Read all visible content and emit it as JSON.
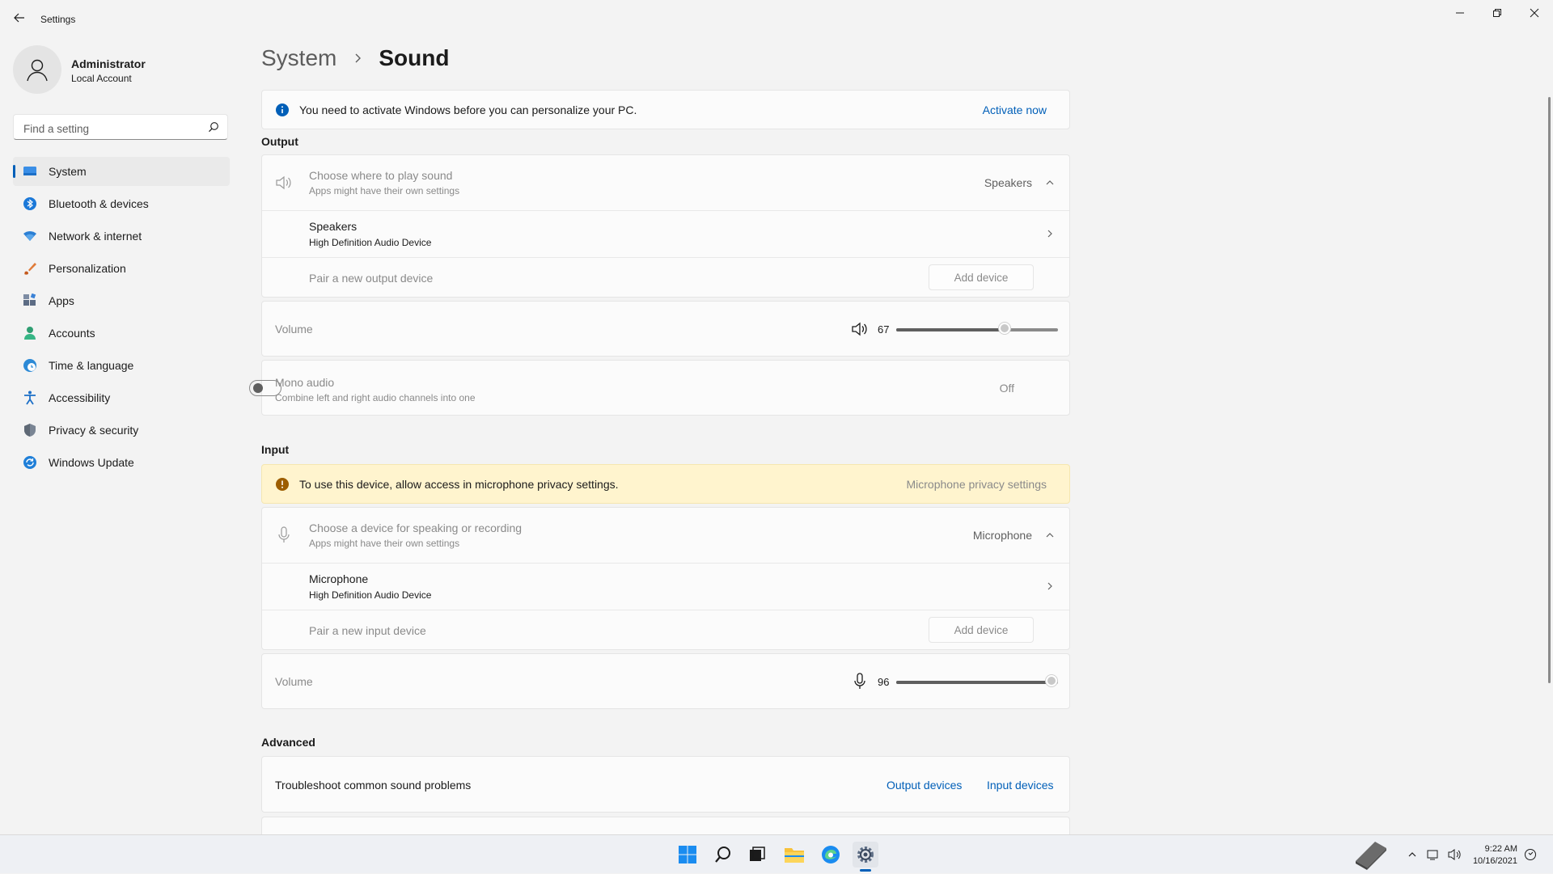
{
  "window": {
    "title": "Settings",
    "controls": [
      "minimize",
      "restore",
      "close"
    ]
  },
  "account": {
    "name": "Administrator",
    "type": "Local Account"
  },
  "search": {
    "placeholder": "Find a setting"
  },
  "sidebar": {
    "items": [
      {
        "label": "System",
        "icon": "system-icon",
        "active": true
      },
      {
        "label": "Bluetooth & devices",
        "icon": "bluetooth-icon"
      },
      {
        "label": "Network & internet",
        "icon": "wifi-icon"
      },
      {
        "label": "Personalization",
        "icon": "brush-icon"
      },
      {
        "label": "Apps",
        "icon": "apps-icon"
      },
      {
        "label": "Accounts",
        "icon": "person-icon"
      },
      {
        "label": "Time & language",
        "icon": "globe-clock-icon"
      },
      {
        "label": "Accessibility",
        "icon": "accessibility-icon"
      },
      {
        "label": "Privacy & security",
        "icon": "shield-icon"
      },
      {
        "label": "Windows Update",
        "icon": "update-icon"
      }
    ]
  },
  "breadcrumb": {
    "parent": "System",
    "current": "Sound"
  },
  "activation_banner": {
    "text": "You need to activate Windows before you can personalize your PC.",
    "link": "Activate now"
  },
  "output": {
    "section_title": "Output",
    "choose": {
      "title": "Choose where to play sound",
      "subtitle": "Apps might have their own settings",
      "value": "Speakers"
    },
    "device": {
      "title": "Speakers",
      "subtitle": "High Definition Audio Device"
    },
    "pair": {
      "label": "Pair a new output device",
      "button": "Add device"
    },
    "volume": {
      "label": "Volume",
      "value": "67",
      "level": 67
    },
    "mono": {
      "title": "Mono audio",
      "subtitle": "Combine left and right audio channels into one",
      "state": "Off"
    }
  },
  "input": {
    "section_title": "Input",
    "warning": {
      "text": "To use this device, allow access in microphone privacy settings.",
      "link": "Microphone privacy settings"
    },
    "choose": {
      "title": "Choose a device for speaking or recording",
      "subtitle": "Apps might have their own settings",
      "value": "Microphone"
    },
    "device": {
      "title": "Microphone",
      "subtitle": "High Definition Audio Device"
    },
    "pair": {
      "label": "Pair a new input device",
      "button": "Add device"
    },
    "volume": {
      "label": "Volume",
      "value": "96",
      "level": 96
    }
  },
  "advanced": {
    "section_title": "Advanced",
    "troubleshoot": {
      "label": "Troubleshoot common sound problems",
      "output_link": "Output devices",
      "input_link": "Input devices"
    }
  },
  "taskbar": {
    "apps": [
      "start-icon",
      "search-icon",
      "task-view-icon",
      "file-explorer-icon",
      "edge-icon",
      "settings-icon"
    ],
    "time": "9:22 AM",
    "date": "10/16/2021"
  },
  "colors": {
    "accent": "#005fb8",
    "warning_bg": "#fff4ce",
    "window_bg": "#f3f3f3"
  }
}
